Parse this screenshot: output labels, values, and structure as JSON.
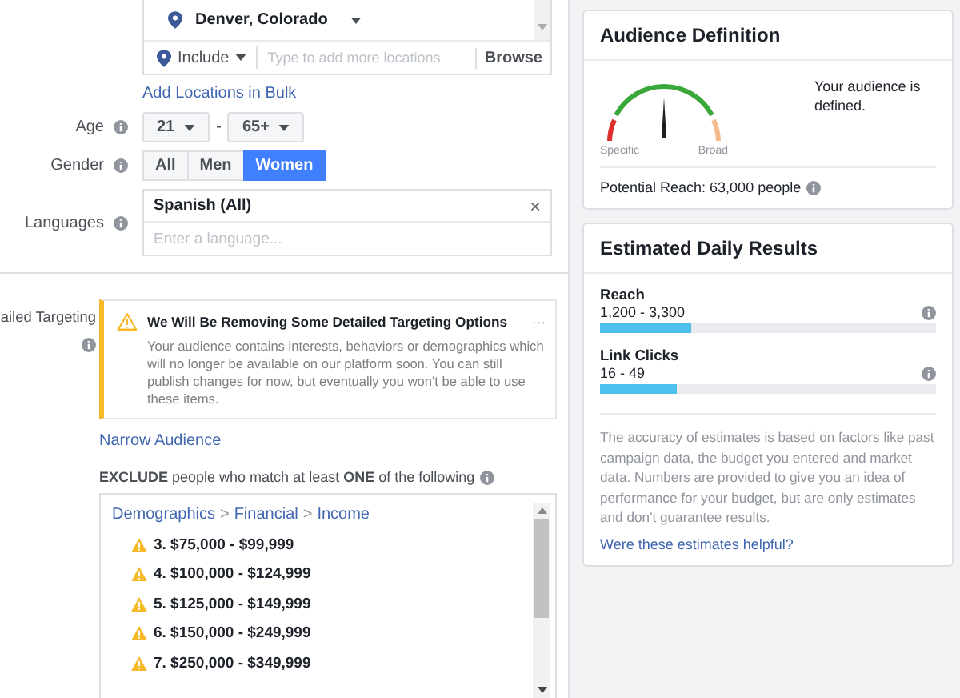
{
  "location": {
    "selected_location": "Denver, Colorado",
    "mode": "Include",
    "placeholder": "Type to add more locations",
    "browse": "Browse"
  },
  "bulk_link": "Add Locations in Bulk",
  "age": {
    "label": "Age",
    "min": "21",
    "separator": "-",
    "max": "65+"
  },
  "gender": {
    "label": "Gender",
    "options": [
      {
        "label": "All",
        "selected": false
      },
      {
        "label": "Men",
        "selected": false
      },
      {
        "label": "Women",
        "selected": true
      }
    ]
  },
  "languages": {
    "label": "Languages",
    "chosen": "Spanish (All)",
    "remove": "×",
    "placeholder": "Enter a language..."
  },
  "detailed_targeting": {
    "label": "ailed Targeting",
    "notice": {
      "title": "We Will Be Removing Some Detailed Targeting Options",
      "menu": "···",
      "body": "Your audience contains interests, behaviors or demographics which will no longer be available on our platform soon. You can still publish changes for now, but eventually you won't be able to use these items."
    },
    "narrow_link": "Narrow Audience",
    "exclude_heading": "**EXCLUDE** people who match at least **ONE** of the following",
    "breadcrumb": [
      {
        "label": "Demographics"
      },
      {
        "label": "Financial"
      },
      {
        "label": "Income"
      }
    ],
    "breadcrumb_separator": ">",
    "items": [
      {
        "label": "3. $75,000 - $99,999"
      },
      {
        "label": "4. $100,000 - $124,999"
      },
      {
        "label": "5. $125,000 - $149,999"
      },
      {
        "label": "6. $150,000 - $249,999"
      },
      {
        "label": "7. $250,000 - $349,999"
      }
    ]
  },
  "audience_definition": {
    "title": "Audience Definition",
    "specific": "Specific",
    "broad": "Broad",
    "status": "Your audience is defined.",
    "reach": "Potential Reach: 63,000 people"
  },
  "daily_results": {
    "title": "Estimated Daily Results",
    "metrics": [
      {
        "name": "Reach",
        "range": "1,200 - 3,300",
        "level": 0.27
      },
      {
        "name": "Link Clicks",
        "range": "16 - 49",
        "level": 0.23
      }
    ],
    "disclaimer": "The accuracy of estimates is based on factors like past campaign data, the budget you entered and market data. Numbers are provided to give you an idea of performance for your budget, but are only estimates and don't guarantee results.",
    "feedback_link": "Were these estimates helpful?"
  }
}
